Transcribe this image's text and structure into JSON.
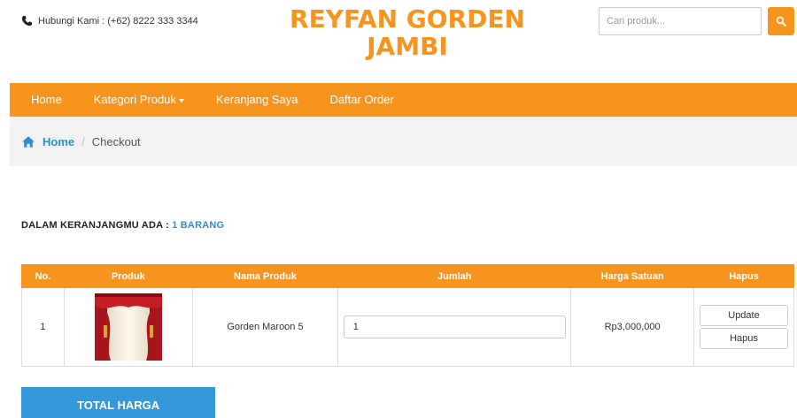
{
  "header": {
    "contact_text": "Hubungi Kami : (+62) 8222 333 3344",
    "brand_line1": "REYFAN GORDEN",
    "brand_line2": "JAMBI",
    "search_placeholder": "Cari produk..."
  },
  "nav": {
    "items": [
      "Home",
      "Kategori Produk",
      "Keranjang Saya",
      "Daftar Order"
    ]
  },
  "breadcrumb": {
    "home": "Home",
    "separator": "/",
    "current": "Checkout"
  },
  "cart": {
    "summary_label": "DALAM KERANJANGMU ADA :",
    "summary_count": "1 BARANG",
    "columns": [
      "No.",
      "Produk",
      "Nama Produk",
      "Jumlah",
      "Harga Satuan",
      "Hapus"
    ],
    "rows": [
      {
        "no": "1",
        "name": "Gorden Maroon 5",
        "qty": "1",
        "price": "Rp3,000,000",
        "update_label": "Update",
        "delete_label": "Hapus"
      }
    ]
  },
  "total": {
    "label": "TOTAL HARGA"
  },
  "colors": {
    "accent": "#f7941d",
    "link": "#2e8fc7",
    "total_bg": "#3498db"
  }
}
